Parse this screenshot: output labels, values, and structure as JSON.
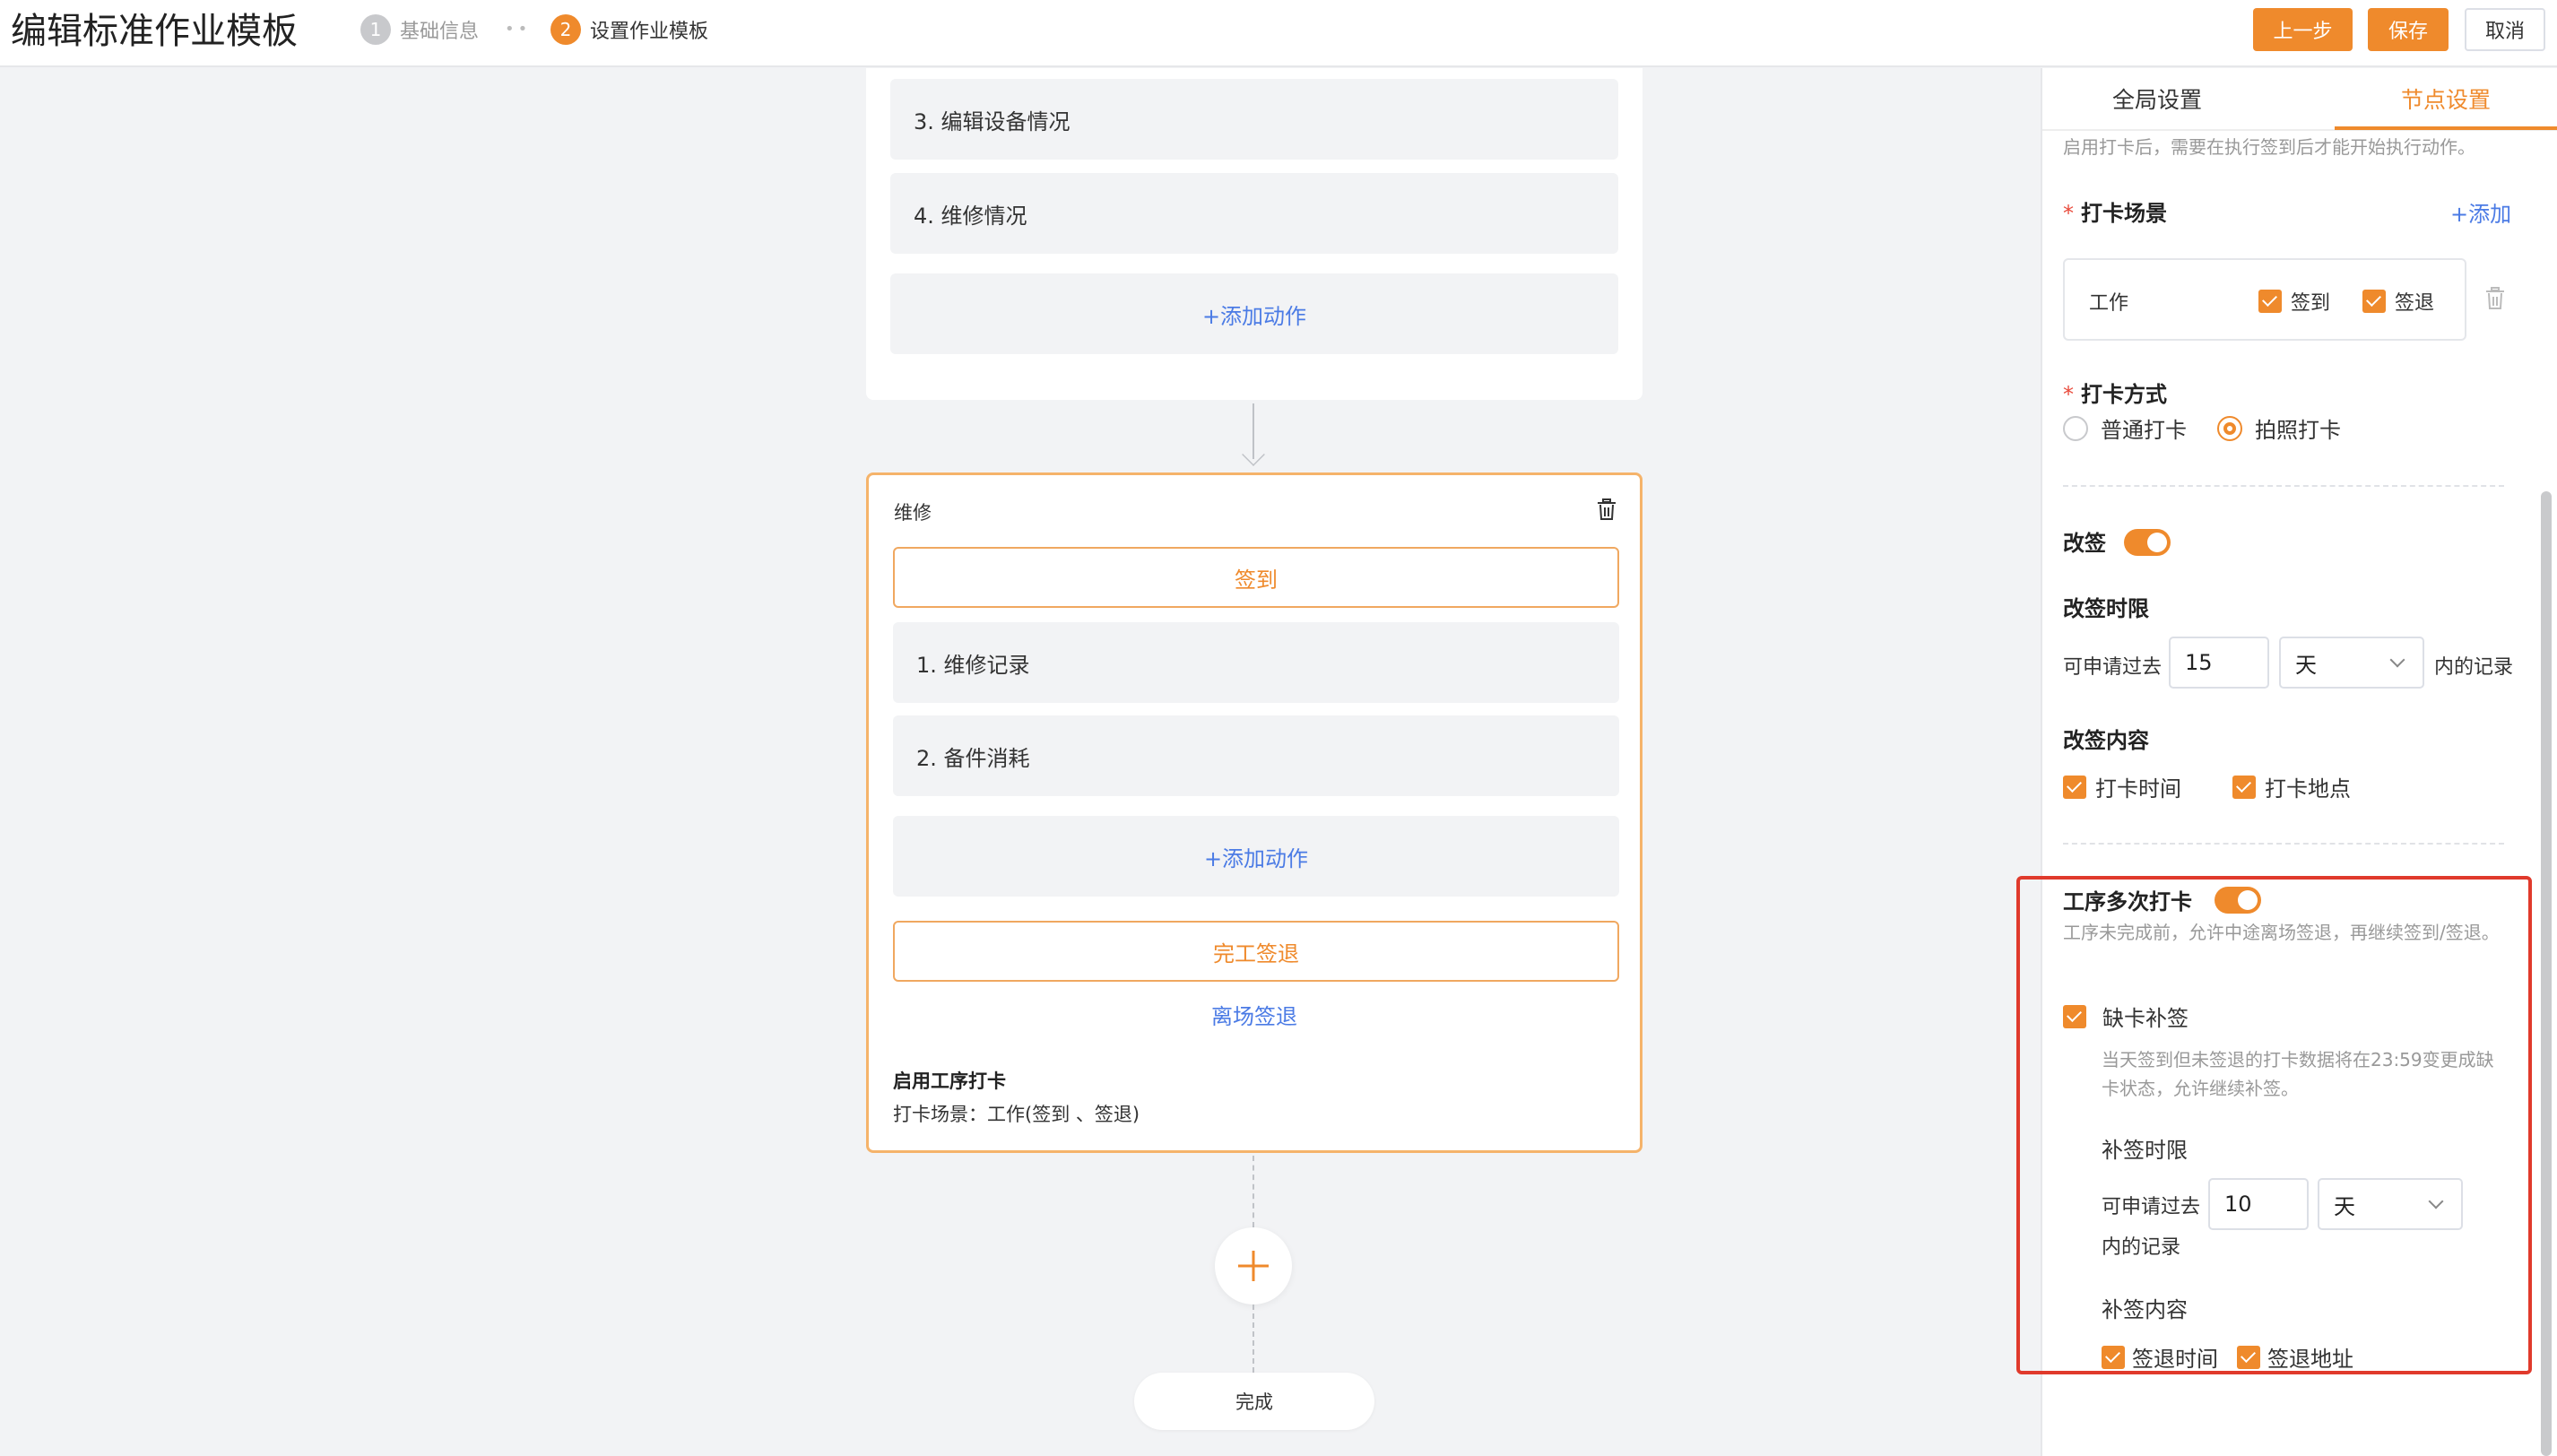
{
  "header": {
    "title": "编辑标准作业模板",
    "steps": [
      {
        "num": "1",
        "label": "基础信息"
      },
      {
        "num": "2",
        "label": "设置作业模板"
      }
    ],
    "step_separator": "••",
    "buttons": {
      "prev": "上一步",
      "save": "保存",
      "cancel": "取消"
    }
  },
  "canvas": {
    "top_card": {
      "actions": [
        "3. 编辑设备情况",
        "4. 维修情况"
      ],
      "add_action": "+添加动作"
    },
    "node": {
      "title": "维修",
      "checkin": "签到",
      "actions": [
        "1. 维修记录",
        "2. 备件消耗"
      ],
      "add_action": "+添加动作",
      "finish_checkout": "完工签退",
      "leave_checkout": "离场签退",
      "footer_title": "启用工序打卡",
      "footer_text": "打卡场景：工作(签到 、签退)"
    },
    "finish": "完成"
  },
  "panel": {
    "tabs": {
      "global": "全局设置",
      "node": "节点设置"
    },
    "top_hint": "启用打卡后，需要在执行签到后才能开始执行动作。",
    "scene": {
      "label": "打卡场景",
      "required_mark": "*",
      "add_link": "+添加",
      "row_name": "工作",
      "checkin": "签到",
      "checkout": "签退"
    },
    "method": {
      "label": "打卡方式",
      "required_mark": "*",
      "options": [
        "普通打卡",
        "拍照打卡"
      ],
      "selected": "拍照打卡"
    },
    "resign": {
      "label": "改签",
      "enabled": true,
      "limit_label": "改签时限",
      "limit_prefix": "可申请过去",
      "limit_value": "15",
      "limit_unit": "天",
      "limit_suffix": "内的记录",
      "content_label": "改签内容",
      "content_options": [
        "打卡时间",
        "打卡地点"
      ]
    },
    "multi": {
      "label": "工序多次打卡",
      "enabled": true,
      "hint": "工序未完成前，允许中途离场签退，再继续签到/签退。",
      "miss": {
        "label": "缺卡补签",
        "checked": true,
        "hint": "当天签到但未签退的打卡数据将在23:59变更成缺卡状态，允许继续补签。",
        "limit_label": "补签时限",
        "limit_prefix": "可申请过去",
        "limit_value": "10",
        "limit_unit": "天",
        "limit_suffix": "内的记录",
        "content_label": "补签内容",
        "content_options": [
          "签退时间",
          "签退地址"
        ]
      }
    }
  },
  "colors": {
    "accent": "#ef8a2c",
    "link": "#4b7be5",
    "highlight_border": "#e03a2c"
  }
}
